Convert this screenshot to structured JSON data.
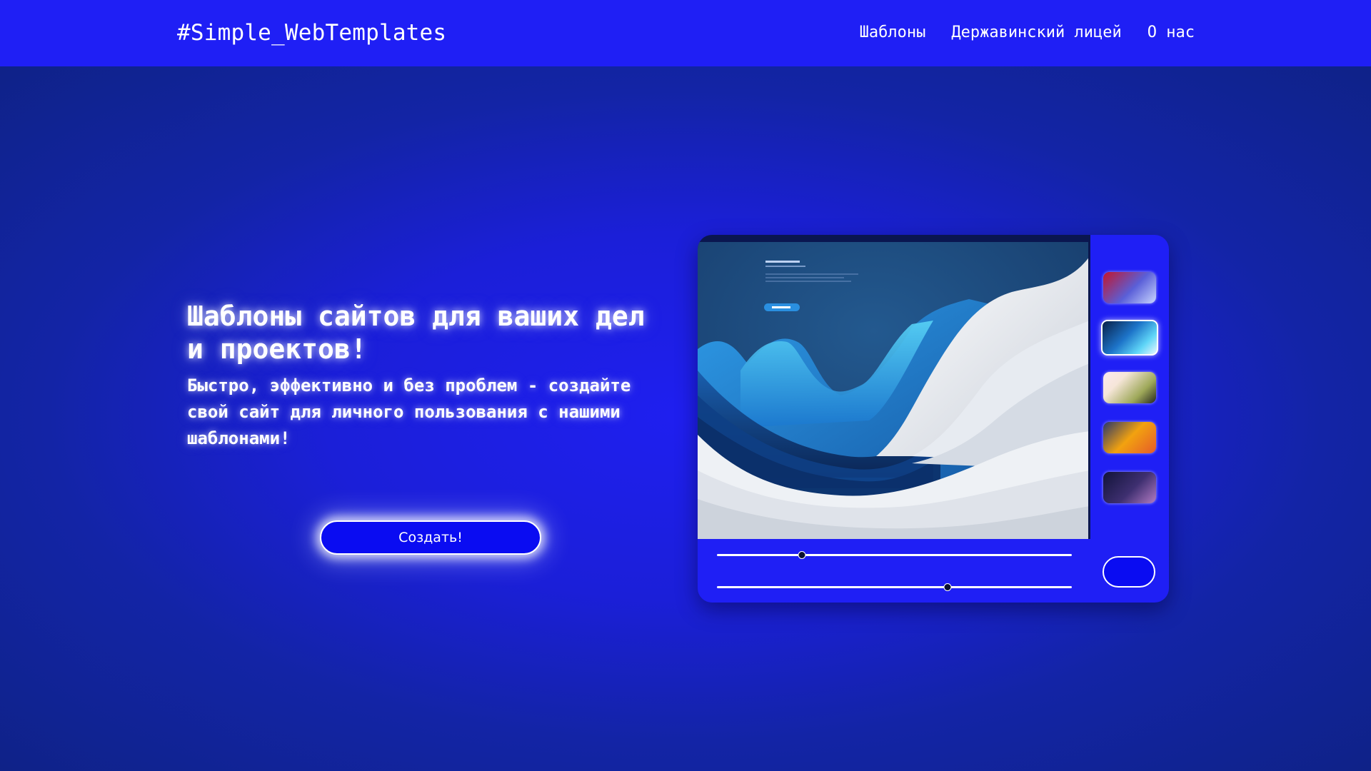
{
  "header": {
    "brand": "#Simple_WebTemplates",
    "nav": [
      {
        "label": "Шаблоны"
      },
      {
        "label": "Державинский лицей"
      },
      {
        "label": "О нас"
      }
    ]
  },
  "hero": {
    "title": "Шаблоны сайтов для ваших дел и проектов!",
    "subtitle": "Быстро, эффективно и без проблем - создайте свой сайт для личного пользования с нашими шаблонами!",
    "cta_label": "Создать!"
  },
  "editor": {
    "sliders": [
      {
        "value": 0.24
      },
      {
        "value": 0.65
      }
    ],
    "selected_swatch": 1
  },
  "colors": {
    "header_bg": "#1f1ff5",
    "accent": "#0a0cf2",
    "background": "#13249f"
  }
}
